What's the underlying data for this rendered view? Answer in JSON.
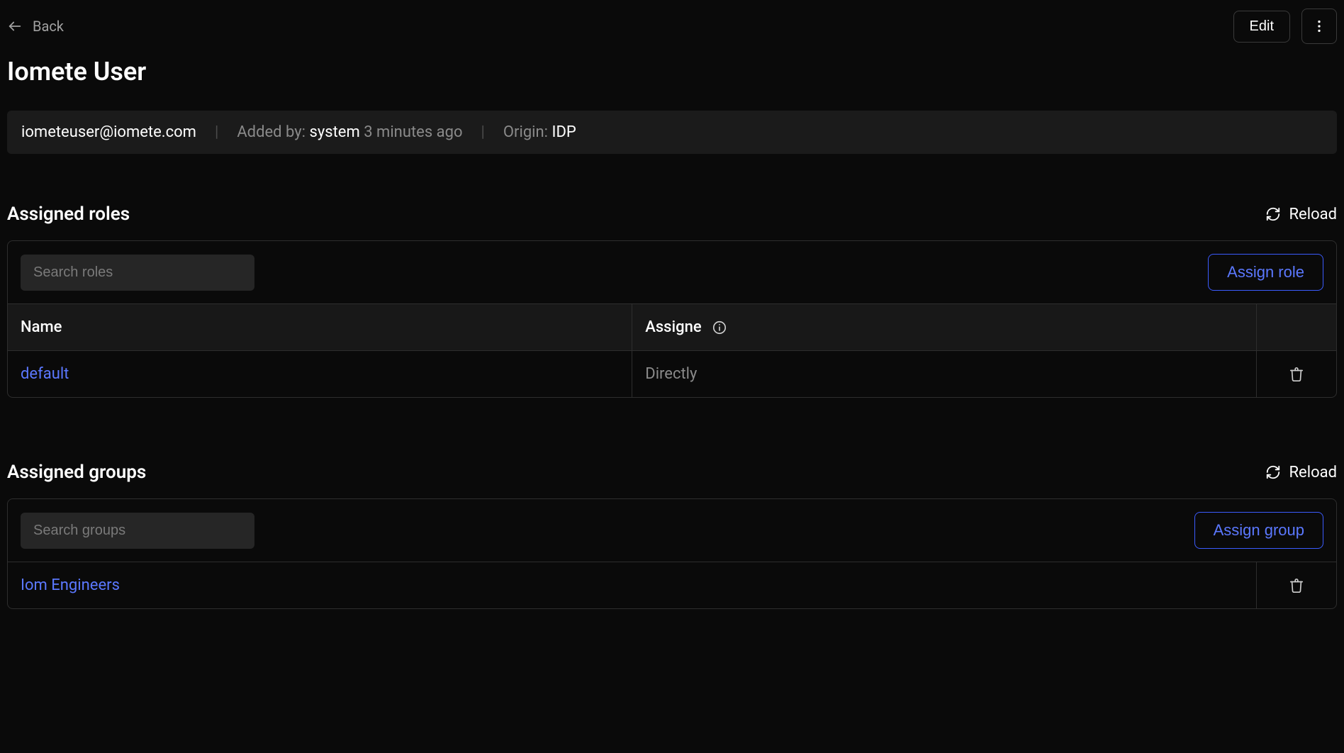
{
  "back_label": "Back",
  "edit_label": "Edit",
  "page_title": "Iomete User",
  "info": {
    "email": "iometeuser@iomete.com",
    "added_by_label": "Added by:",
    "added_by_value": "system",
    "added_time": "3 minutes ago",
    "origin_label": "Origin:",
    "origin_value": "IDP"
  },
  "reload_label": "Reload",
  "roles": {
    "section_title": "Assigned roles",
    "search_placeholder": "Search roles",
    "assign_label": "Assign role",
    "columns": {
      "name": "Name",
      "assigne": "Assigne"
    },
    "rows": [
      {
        "name": "default",
        "assigne": "Directly"
      }
    ]
  },
  "groups": {
    "section_title": "Assigned groups",
    "search_placeholder": "Search groups",
    "assign_label": "Assign group",
    "rows": [
      {
        "name": "Iom Engineers"
      }
    ]
  }
}
